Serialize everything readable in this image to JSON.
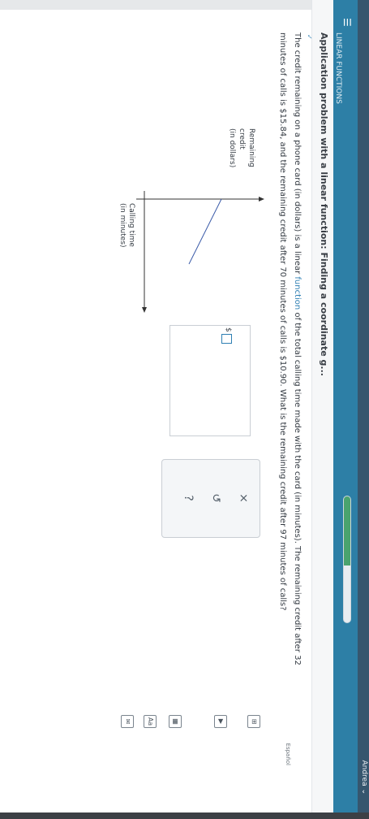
{
  "topbar": {
    "user_name": "Andrea"
  },
  "header": {
    "module": "LINEAR FUNCTIONS",
    "title": "Application problem with a linear function: Finding a coordinate g...",
    "language_link": "Español",
    "progress_fraction": 0.55
  },
  "question": {
    "text_before_link": "The credit remaining on a phone card (in dollars) is a linear ",
    "link": "function",
    "text_after_link": " of the total calling time made with the card (in minutes). The remaining credit after 32 minutes of calls is $15.84, and the remaining credit after 70 minutes of calls is $10.90. What is the remaining credit after 97 minutes of calls?"
  },
  "graph": {
    "y_label_line1": "Remaining",
    "y_label_line2": "credit",
    "y_label_line3": "(in dollars)",
    "x_label_line1": "Calling time",
    "x_label_line2": "(in minutes)"
  },
  "answer": {
    "prefix": "$",
    "value": ""
  },
  "actions": {
    "clear": "×",
    "undo": "↺",
    "help": "?"
  },
  "tools": {
    "calculator": "⊞",
    "video": "▶",
    "table": "▦",
    "atlas": "Aa",
    "mail": "✉"
  }
}
